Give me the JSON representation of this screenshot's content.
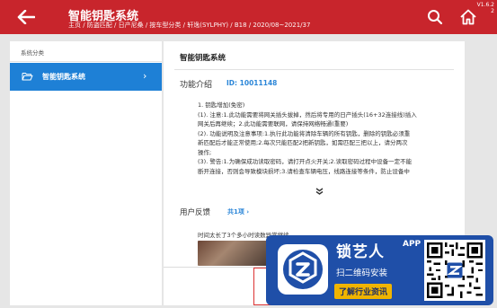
{
  "header": {
    "title": "智能钥匙系统",
    "breadcrumb": "主页 / 防盗匹配 / 日产尼桑 / 按车型分类 / 轩逸(SYLPHY) / B18 / 2020/08~2021/37",
    "version_line1": "V1.6.2",
    "version_line2": "2"
  },
  "sidebar": {
    "category_label": "系统分类",
    "items": [
      {
        "label": "智能钥匙系统",
        "selected": true
      }
    ]
  },
  "main": {
    "title": "智能钥匙系统",
    "intro_label": "功能介绍",
    "intro_id": "ID: 10011148",
    "description_lines": [
      "1. 钥匙增加(免密)",
      "(1). 注意:1.此功能需要将网关插头拔掉，然后将专用的日产插头(16+32连接线)插入",
      "网关后再继续；2.此功能需要联网，请保持网络畅通(重要)",
      "(2). 功能说明及注意事项:1.执行此功能将清除车辆的所有钥匙，删除的钥匙必须重",
      "新匹配后才能正常使用;2.每次只能匹配2把新钥匙，如需匹配三把以上，请分两次",
      "操作;",
      "(3). 警告:1.为确保成功读取密码，请打开点火开关;2.读取密码过程中设备一定不能",
      "断开连接，否则会导致模块损坏;3.请检查车辆电压，线路连接等条件，防止设备中"
    ],
    "expand_icon": "double-chevron-down",
    "feedback_label": "用户反馈",
    "feedback_count": "共1项 ›",
    "comment_text": "时间太长了3个多小时读数异常继续"
  },
  "ad": {
    "brand": "锁艺人",
    "app_tag": "APP",
    "line1": "扫二维码安装",
    "line2": "了解行业资讯",
    "brand_color": "#1f4fa8",
    "accent_color": "#f0b400"
  },
  "colors": {
    "header_bg": "#c8252c",
    "sidebar_selected": "#1e80d6",
    "link_blue": "#2b86d8"
  }
}
